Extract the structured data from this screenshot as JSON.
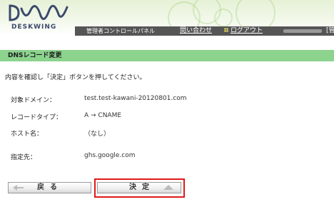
{
  "header": {
    "logo_text": "DESKWING",
    "nav_title": "管理者コントロールパネル",
    "contact_link": "問い合わせ",
    "logout_link": "ログアウト",
    "nav_cut_text": "[管"
  },
  "section": {
    "title": "DNSレコード変更"
  },
  "instruction": "内容を確認し「決定」ボタンを押してください。",
  "details": {
    "domain_label": "対象ドメイン：",
    "domain_value": "test.test-kawani-20120801.com",
    "type_label": "レコードタイプ：",
    "type_value": "A → CNAME",
    "host_label": "ホスト名：",
    "host_value": "（なし）",
    "target_label": "指定先：",
    "target_value": "ghs.google.com"
  },
  "buttons": {
    "back_label": "戻る",
    "ok_label": "決定"
  },
  "colors": {
    "section_bg": "#8cd38e",
    "navbar_bg": "#555555",
    "highlight": "#e0191a"
  },
  "icons": {
    "logo": "deskwing-wave-logo",
    "logout": "dots-icon",
    "back": "arrow-left-icon",
    "ok": "arrow-up-icon"
  }
}
